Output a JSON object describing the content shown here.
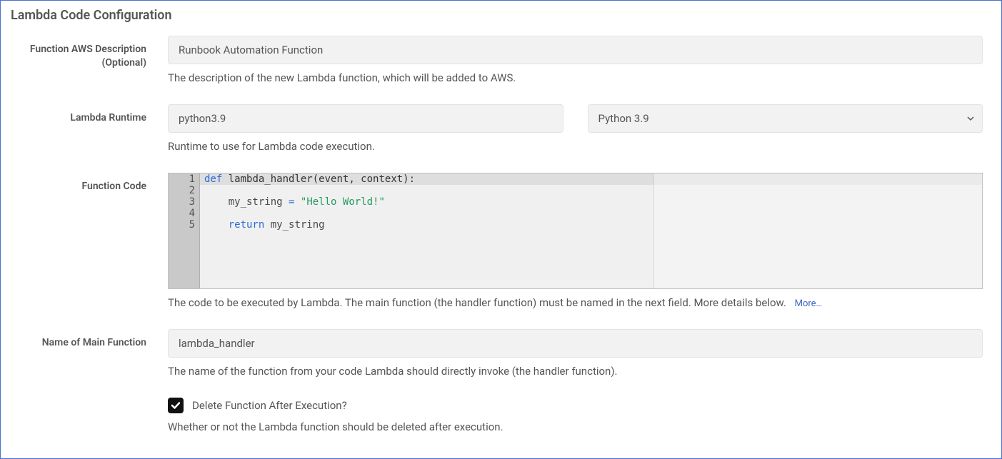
{
  "panel": {
    "title": "Lambda Code Configuration"
  },
  "description": {
    "label": "Function AWS Description (Optional)",
    "value": "Runbook Automation Function",
    "help": "The description of the new Lambda function, which will be added to AWS."
  },
  "runtime": {
    "label": "Lambda Runtime",
    "value": "python3.9",
    "selected": "Python 3.9",
    "help": "Runtime to use for Lambda code execution."
  },
  "code": {
    "label": "Function Code",
    "line_numbers": [
      "1",
      "2",
      "3",
      "4",
      "5"
    ],
    "raw": "def lambda_handler(event, context):\n\n    my_string = \"Hello World!\"\n\n    return my_string",
    "help": "The code to be executed by Lambda. The main function (the handler function) must be named in the next field. More details below.",
    "more_label": "More…"
  },
  "main_fn": {
    "label": "Name of Main Function",
    "value": "lambda_handler",
    "help": "The name of the function from your code Lambda should directly invoke (the handler function)."
  },
  "delete_after": {
    "label": "Delete Function After Execution?",
    "checked": true,
    "help": "Whether or not the Lambda function should be deleted after execution."
  }
}
